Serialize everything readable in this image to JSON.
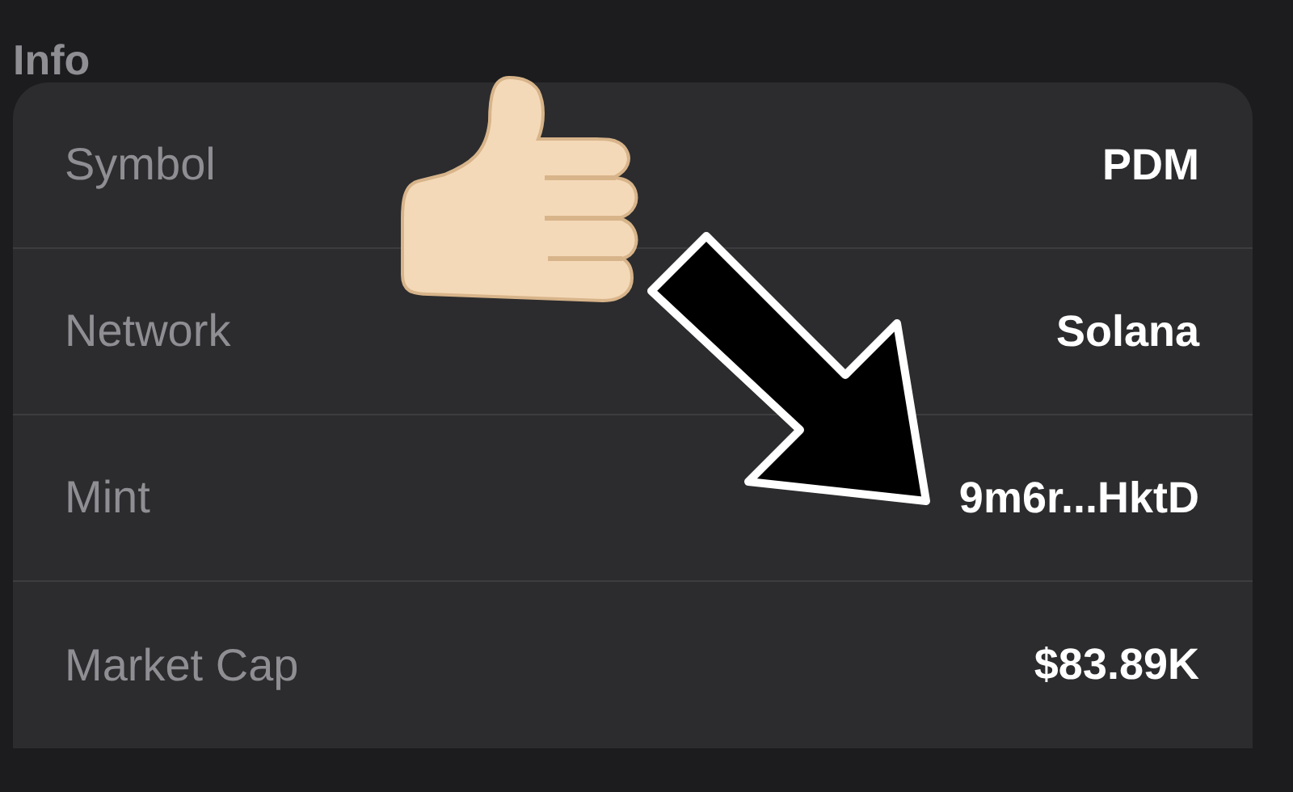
{
  "section_title": "Info",
  "rows": [
    {
      "label": "Symbol",
      "value": "PDM"
    },
    {
      "label": "Network",
      "value": "Solana"
    },
    {
      "label": "Mint",
      "value": "9m6r...HktD"
    },
    {
      "label": "Market Cap",
      "value": "$83.89K"
    }
  ]
}
